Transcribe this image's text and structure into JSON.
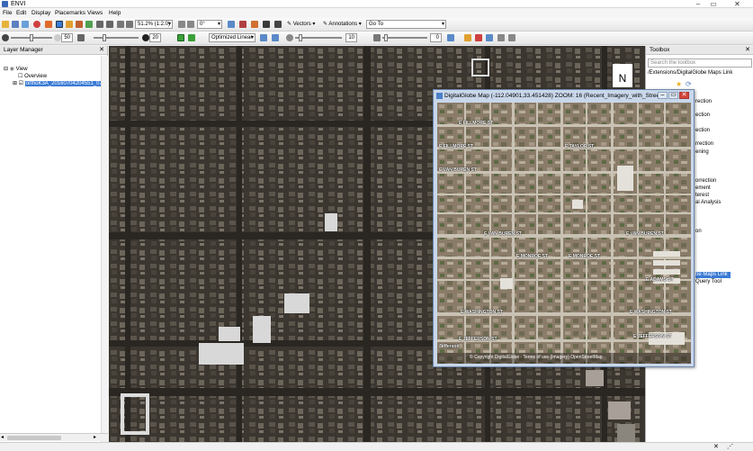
{
  "app": {
    "title": "ENVI"
  },
  "menu": [
    "File",
    "Edit",
    "Display",
    "Placemarks",
    "Views",
    "Help"
  ],
  "toolbar1": {
    "zoom_value": "51.2% (1:2.0)",
    "rotation_value": "0°",
    "vectors_label": "Vectors",
    "annotations_label": "Annotations",
    "goto_label": "Go To"
  },
  "toolbar2": {
    "brightness_value": "50",
    "contrast_value": "20",
    "stretch_value": "Optimized Linear",
    "sharpen_value": "10",
    "transparency_value": "0"
  },
  "layer_manager": {
    "title": "Layer Manager",
    "view_label": "View",
    "overview_label": "Overview",
    "layer_label": "orthoK3A_20160704204551_07"
  },
  "toolbox": {
    "title": "Toolbox",
    "search_placeholder": "Search the toolbox",
    "path": "/Extensions/DigitalGlobe Maps Link",
    "items": [
      "rection",
      "ection",
      "ection",
      "rrection",
      "ening",
      "orrection",
      "ement",
      "terest",
      "al Analysis",
      "on",
      "be Maps Link",
      "Query Tool"
    ],
    "selected_index": 10
  },
  "dg_window": {
    "title": "DigitalGlobe Map (-112.04901,33.451428) ZOOM: 16 (Recent_Imagery_with_Streets)",
    "attribution": "© Copyright DigitalGlobe - Terms of use (Imagery) OpenStreetMap",
    "streets": [
      "E FILLMORE ST",
      "E FILLMORE ST",
      "E TAYLOR ST",
      "E VAN BUREN ST",
      "E VAN BUREN ST",
      "E MONROE ST",
      "E MONROE ST",
      "E ADAMS ST",
      "E WASHINGTON ST",
      "E WASHINGTON ST",
      "E JEFFERSON ST",
      "E JEFFERSON ST",
      "Jefferson"
    ]
  },
  "map": {
    "north_label": "N"
  },
  "colors": {
    "selection": "#3a7bd5",
    "window_frame": "#c9d7ea",
    "toolbox_highlight": "#3a7bd5"
  }
}
